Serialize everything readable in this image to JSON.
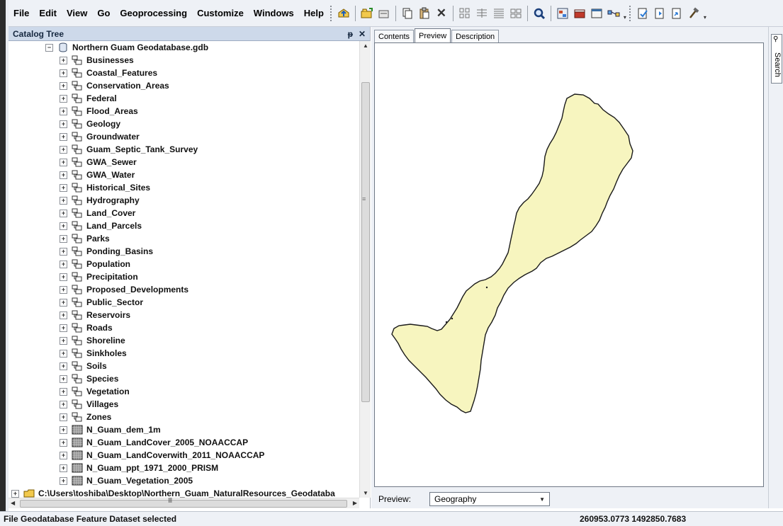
{
  "menu": {
    "items": [
      "File",
      "Edit",
      "View",
      "Go",
      "Geoprocessing",
      "Customize",
      "Windows",
      "Help"
    ]
  },
  "toolbar": {
    "icons": [
      "up-one-level-icon",
      "connect-folder-icon",
      "disconnect-folder-icon",
      "copy-icon",
      "paste-icon",
      "delete-icon",
      "large-icons-view-icon",
      "list-view-icon",
      "details-view-icon",
      "thumbnails-view-icon",
      "search-window-icon",
      "catalog-tree-icon",
      "arctoolbox-icon",
      "python-window-icon",
      "model-builder-icon",
      "metadata-icon",
      "import-metadata-icon",
      "export-metadata-icon",
      "hammer-tool-icon"
    ]
  },
  "catalog": {
    "title": "Catalog Tree",
    "pin_symbol": "٩",
    "close_symbol": "✕",
    "geodatabase": "Northern Guam Geodatabase.gdb",
    "feature_datasets": [
      "Businesses",
      "Coastal_Features",
      "Conservation_Areas",
      "Federal",
      "Flood_Areas",
      "Geology",
      "Groundwater",
      "Guam_Septic_Tank_Survey",
      "GWA_Sewer",
      "GWA_Water",
      "Historical_Sites",
      "Hydrography",
      "Land_Cover",
      "Land_Parcels",
      "Parks",
      "Ponding_Basins",
      "Population",
      "Precipitation",
      "Proposed_Developments",
      "Public_Sector",
      "Reservoirs",
      "Roads",
      "Shoreline",
      "Sinkholes",
      "Soils",
      "Species",
      "Vegetation",
      "Villages",
      "Zones"
    ],
    "rasters": [
      "N_Guam_dem_1m",
      "N_Guam_LandCover_2005_NOAACCAP",
      "N_Guam_LandCoverwith_2011_NOAACCAP",
      "N_Guam_ppt_1971_2000_PRISM",
      "N_Guam_Vegetation_2005"
    ],
    "partial_path": "C:\\Users\\toshiba\\Desktop\\Northern_Guam_NaturalResources_Geodataba"
  },
  "tabs": {
    "contents": "Contents",
    "preview": "Preview",
    "description": "Description"
  },
  "preview": {
    "label": "Preview:",
    "selected": "Geography",
    "fill_color": "#f7f5bf",
    "outline_color": "#1a1a1a"
  },
  "search_tab": {
    "label": "Search"
  },
  "status": {
    "message": "File Geodatabase Feature Dataset selected",
    "coordinates": "260953.0773  1492850.7683"
  }
}
